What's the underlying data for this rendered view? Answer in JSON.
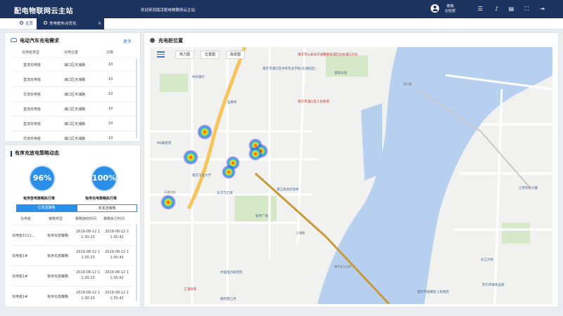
{
  "header": {
    "brand": "配电物联网云主站",
    "welcome": "欢迎来到南京配电物联网云主站",
    "user_line1": "南瑞",
    "user_line2": "云检部",
    "icons": [
      "user-icon",
      "list-icon",
      "bell-icon",
      "document-icon",
      "fullscreen-icon",
      "logout-icon"
    ]
  },
  "tabs": [
    {
      "label": "主页",
      "active": false
    },
    {
      "label": "充电桩布点优化",
      "active": true,
      "close": "×"
    }
  ],
  "demand": {
    "title": "电动汽车充电需求",
    "more": "更多",
    "columns": [
      "充电桩类型",
      "充电位置",
      "次数"
    ],
    "rows": [
      [
        "直流充电桩",
        "浦口区天浦路",
        "10"
      ],
      [
        "直流充电桩",
        "浦口区天浦路",
        "10"
      ],
      [
        "交流充电桩",
        "浦口区天浦路",
        "10"
      ],
      [
        "直流充电桩",
        "浦口区天浦路",
        "10"
      ],
      [
        "直流充电桩",
        "浦口区天浦路",
        "10"
      ],
      [
        "交流充电桩",
        "浦口区天浦路",
        "10"
      ]
    ]
  },
  "strategy": {
    "title": "有序充放电策略动态",
    "gauges": [
      {
        "value": "96%",
        "label": "有序放电策略执行率"
      },
      {
        "value": "100%",
        "label": "有序充电策略执行率"
      }
    ],
    "toggle": {
      "on": "已发送策略",
      "off": "未发送策略"
    },
    "columns": [
      "充电桩",
      "策略类型",
      "策略接收时间",
      "策略执行时间"
    ],
    "rows": [
      {
        "pile": "充电桩1111...",
        "type": "有序充放策略",
        "recv1": "2019-08-12 1",
        "recv2": "1:30:23",
        "exec1": "2019-08-12 1",
        "exec2": "1:35:42"
      },
      {
        "pile": "充电桩1#",
        "type": "有序充放策略",
        "recv1": "2019-08-12 1",
        "recv2": "1:30:23",
        "exec1": "2019-08-12 1",
        "exec2": "1:35:42"
      },
      {
        "pile": "充电桩1#",
        "type": "有序充放策略",
        "recv1": "2019-08-12 1",
        "recv2": "1:30:23",
        "exec1": "2019-08-12 1",
        "exec2": "1:35:42"
      },
      {
        "pile": "充电桩1#",
        "type": "有序充放策略",
        "recv1": "2019-08-12 1",
        "recv2": "1:30:23",
        "exec1": "2019-08-12 1",
        "exec2": "1:35:42"
      }
    ]
  },
  "map": {
    "title": "充电桩位置",
    "buttons": [
      "热力图",
      "位置图",
      "故素图"
    ],
    "pois": [
      {
        "t": "南京市公安局交通警察局城区分局浦口大队",
        "c": "red"
      },
      {
        "t": "南京市浦口区中等专业学校(天浦校区)",
        "c": "blue"
      },
      {
        "t": "南京市浦口区人民政府",
        "c": "red"
      },
      {
        "t": "中华银行",
        "c": "blue"
      },
      {
        "t": "石佛寺",
        "c": "blue"
      },
      {
        "t": "浦滨公园",
        "c": "blue"
      },
      {
        "t": "南京工业大学",
        "c": "blue"
      },
      {
        "t": "东方万汇城",
        "c": "blue"
      },
      {
        "t": "天浦大道",
        "c": "road"
      },
      {
        "t": "滨江路",
        "c": "road"
      },
      {
        "t": "浦江商业综合体",
        "c": "blue"
      },
      {
        "t": "江苏科技大厦",
        "c": "blue"
      },
      {
        "t": "江浦街道",
        "c": "red"
      },
      {
        "t": "南京长江大桥",
        "c": "road"
      },
      {
        "t": "长江大桥",
        "c": "blue"
      },
      {
        "t": "中国电力研究院",
        "c": "blue"
      },
      {
        "t": "和平广场",
        "c": "blue"
      },
      {
        "t": "保利西江月",
        "c": "blue"
      },
      {
        "t": "苏宁环球商业街",
        "c": "blue"
      },
      {
        "t": "南京市鼓楼区人民政府",
        "c": "blue"
      },
      {
        "t": "MS嘉星苑",
        "c": "blue"
      },
      {
        "t": "江浦路",
        "c": "road"
      }
    ],
    "colors": {
      "river": "#b7d0ef",
      "land": "#f1f2ef",
      "expressway": "#f6c45a",
      "road": "#ffffff",
      "green": "#d5e8c8"
    }
  }
}
